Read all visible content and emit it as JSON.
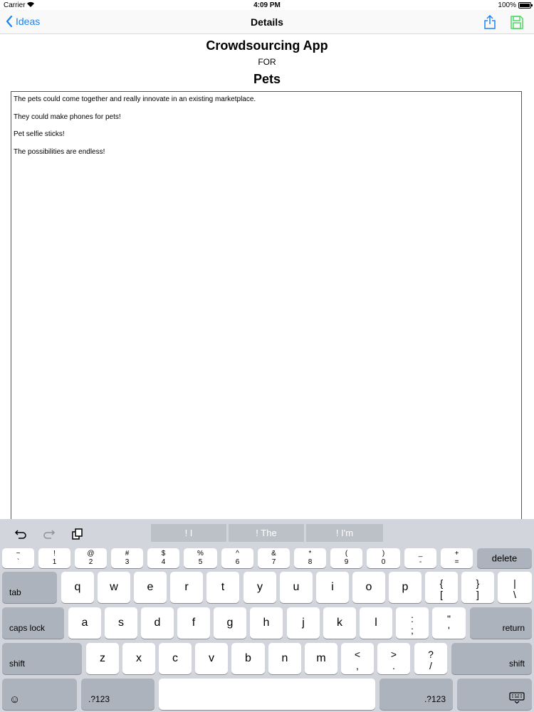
{
  "status_bar": {
    "carrier": "Carrier",
    "time": "4:09 PM",
    "battery": "100%"
  },
  "nav": {
    "back_label": "Ideas",
    "title": "Details"
  },
  "heading": {
    "app_title": "Crowdsourcing App",
    "for_label": "FOR",
    "subject": "Pets"
  },
  "text_view": {
    "lines": [
      "The pets could come together and really innovate in an existing marketplace.",
      "They could make phones for pets!",
      "Pet selfie sticks!",
      "The possibilities are endless!"
    ]
  },
  "keyboard": {
    "suggestions": [
      "! I",
      "! The",
      "! I'm"
    ],
    "number_row": [
      {
        "top": "~",
        "bot": "`"
      },
      {
        "top": "!",
        "bot": "1"
      },
      {
        "top": "@",
        "bot": "2"
      },
      {
        "top": "#",
        "bot": "3"
      },
      {
        "top": "$",
        "bot": "4"
      },
      {
        "top": "%",
        "bot": "5"
      },
      {
        "top": "^",
        "bot": "6"
      },
      {
        "top": "&",
        "bot": "7"
      },
      {
        "top": "*",
        "bot": "8"
      },
      {
        "top": "(",
        "bot": "9"
      },
      {
        "top": ")",
        "bot": "0"
      },
      {
        "top": "_",
        "bot": "-"
      },
      {
        "top": "+",
        "bot": "="
      }
    ],
    "delete": "delete",
    "tab": "tab",
    "row_q": [
      "q",
      "w",
      "e",
      "r",
      "t",
      "y",
      "u",
      "i",
      "o",
      "p"
    ],
    "row_q_symbols": [
      {
        "top": "{",
        "bot": "["
      },
      {
        "top": "}",
        "bot": "]"
      },
      {
        "top": "|",
        "bot": "\\"
      }
    ],
    "caps_lock": "caps lock",
    "row_a": [
      "a",
      "s",
      "d",
      "f",
      "g",
      "h",
      "j",
      "k",
      "l"
    ],
    "row_a_symbols": [
      {
        "top": ":",
        "bot": ";"
      },
      {
        "top": "\"",
        "bot": "'"
      }
    ],
    "return": "return",
    "shift": "shift",
    "row_z": [
      "z",
      "x",
      "c",
      "v",
      "b",
      "n",
      "m"
    ],
    "row_z_symbols": [
      {
        "top": "<",
        "bot": ","
      },
      {
        "top": ">",
        "bot": "."
      },
      {
        "top": "?",
        "bot": "/"
      }
    ],
    "emoji": "☺",
    "numbers": ".?123"
  },
  "colors": {
    "accent": "#1a84f4",
    "save": "#4cd964",
    "keyboard_bg": "#d2d5db"
  }
}
